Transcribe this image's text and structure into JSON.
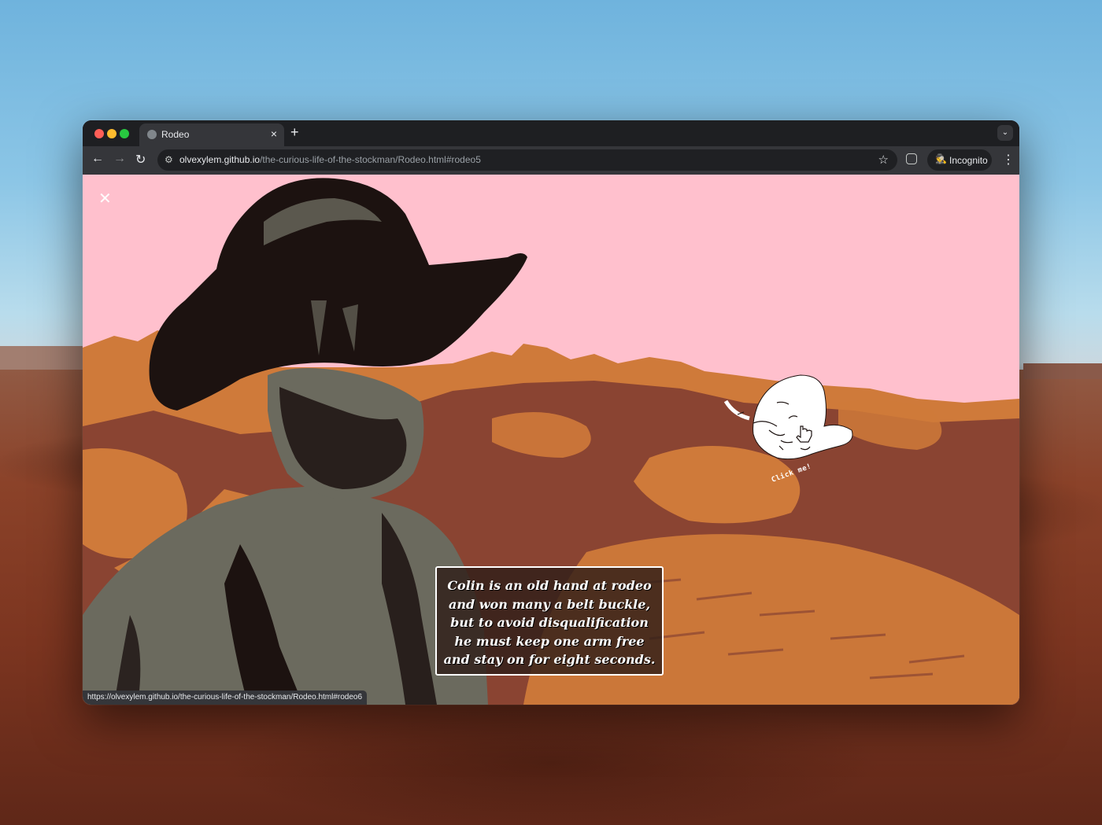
{
  "browser": {
    "tab": {
      "title": "Rodeo",
      "close_glyph": "×"
    },
    "newtab_glyph": "+",
    "tabmenu_glyph": "⌄",
    "nav": {
      "back": "←",
      "forward": "→",
      "reload": "↻"
    },
    "url": {
      "host": "olvexylem.github.io",
      "path": "/the-curious-life-of-the-stockman/Rodeo.html#rodeo5"
    },
    "bookmark_glyph": "☆",
    "incognito_label": "Incognito",
    "menu_glyph": "⋮",
    "status_url": "https://olvexylem.github.io/the-curious-life-of-the-stockman/Rodeo.html#rodeo6"
  },
  "page": {
    "close_glyph": "✕",
    "caption": "Colin is an old hand at rodeo and won many a belt buckle, but to avoid disqualification he must keep one arm free and stay on for eight seconds.",
    "hat_button_label": "Click me!"
  },
  "colors": {
    "sky_pink": "#ffc0cd",
    "orange": "#cf7a3a",
    "rust": "#8a4432",
    "dark": "#1c1210",
    "grey": "#6b6a5e"
  },
  "icons": [
    "close-icon",
    "back-arrow-icon",
    "forward-arrow-icon",
    "reload-icon",
    "site-settings-icon",
    "star-icon",
    "extension-icon",
    "incognito-icon",
    "more-menu-icon",
    "pointer-hand-icon"
  ]
}
